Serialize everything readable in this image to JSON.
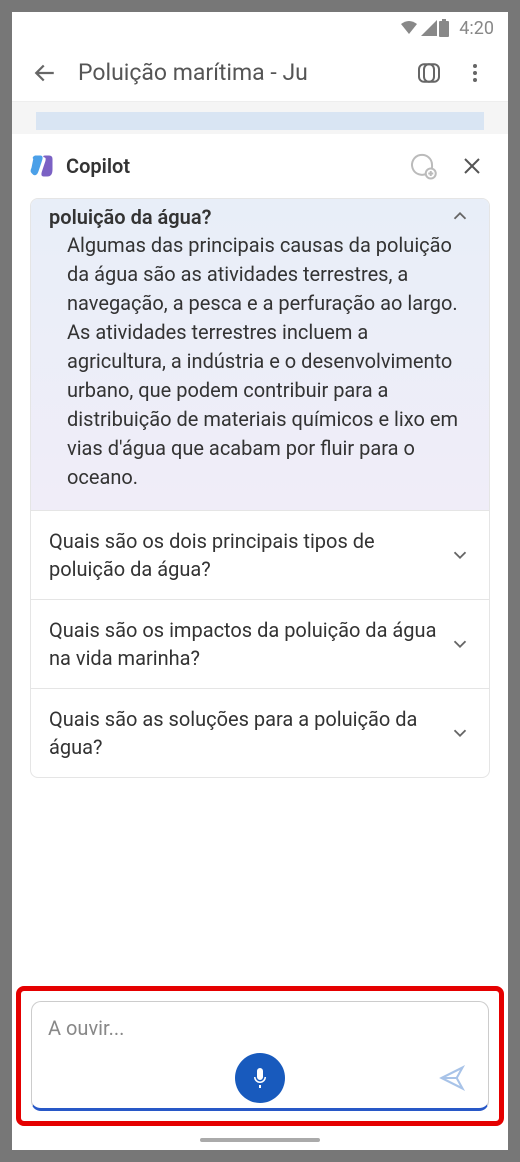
{
  "status": {
    "time": "4:20"
  },
  "header": {
    "title": "Poluição marítima - Ju"
  },
  "copilot": {
    "title": "Copilot"
  },
  "faq": {
    "expanded": {
      "question_partial": "poluição da água?",
      "answer": "Algumas das principais causas da poluição da água são as atividades terrestres, a navegação, a pesca e a perfuração ao largo. As atividades terrestres incluem a agricultura, a indústria e o desenvolvimento urbano, que podem contribuir para a distribuição de materiais químicos e lixo em vias d'água que acabam por fluir para o oceano."
    },
    "collapsed": [
      "Quais são os dois principais tipos de poluição da água?",
      "Quais são os impactos da poluição da água na vida marinha?",
      "Quais são as soluções para a poluição da água?"
    ]
  },
  "input": {
    "placeholder": "A ouvir..."
  }
}
